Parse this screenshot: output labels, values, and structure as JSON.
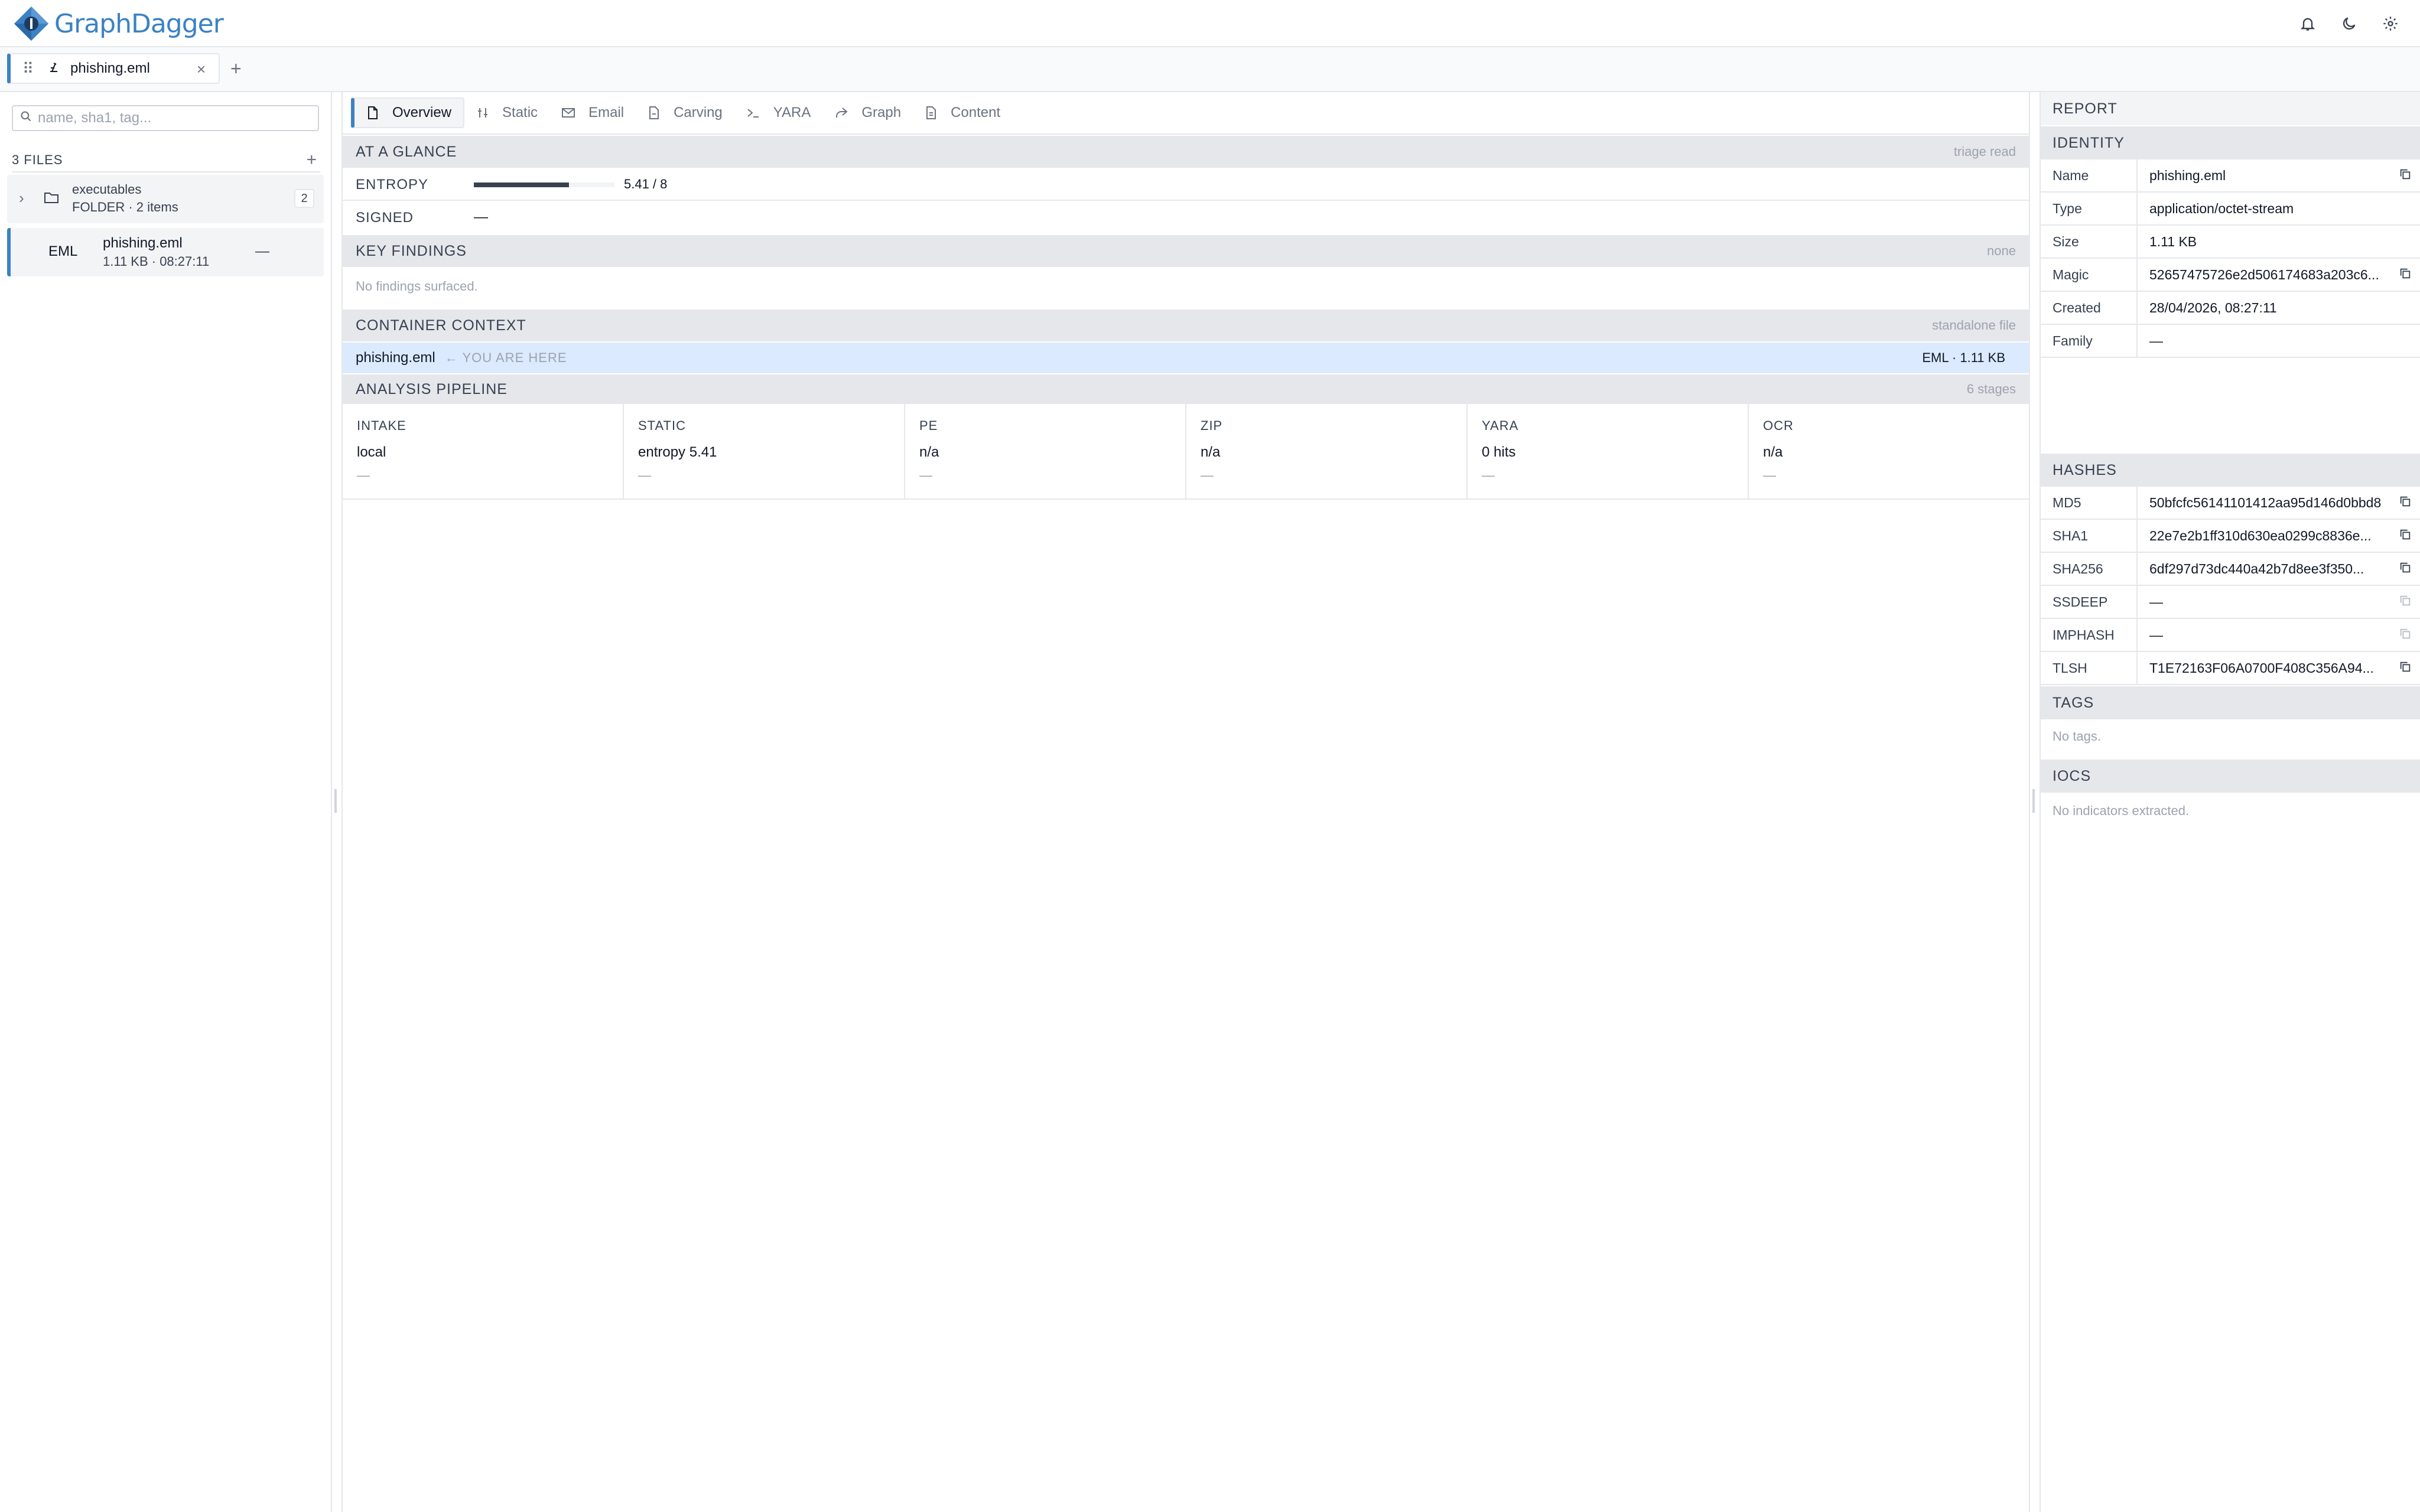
{
  "app": {
    "name": "GraphDagger"
  },
  "doc_tab": {
    "label": "phishing.eml",
    "close": "×",
    "add": "+"
  },
  "sidebar": {
    "search_placeholder": "name, sha1, tag...",
    "files_label": "3 FILES",
    "add": "+",
    "folder": {
      "name": "executables",
      "meta": "FOLDER · 2 items",
      "count": "2"
    },
    "file": {
      "ext": "EML",
      "name": "phishing.eml",
      "meta": "1.11 KB · 08:27:11",
      "status": "—"
    }
  },
  "tabs": [
    {
      "label": "Overview",
      "icon": "file-icon"
    },
    {
      "label": "Static",
      "icon": "sliders-icon"
    },
    {
      "label": "Email",
      "icon": "mail-icon"
    },
    {
      "label": "Carving",
      "icon": "file-cut-icon"
    },
    {
      "label": "YARA",
      "icon": "terminal-icon"
    },
    {
      "label": "Graph",
      "icon": "share-icon"
    },
    {
      "label": "Content",
      "icon": "file-text-icon"
    }
  ],
  "glance": {
    "title": "AT A GLANCE",
    "meta": "triage read",
    "entropy_label": "ENTROPY",
    "entropy_value": 5.41,
    "entropy_max": 8,
    "entropy_text": "5.41 / 8",
    "signed_label": "SIGNED",
    "signed_value": "—"
  },
  "findings": {
    "title": "KEY FINDINGS",
    "meta": "none",
    "empty": "No findings surfaced."
  },
  "context": {
    "title": "CONTAINER CONTEXT",
    "meta": "standalone file",
    "file": "phishing.eml",
    "here": "← YOU ARE HERE",
    "right": "EML · 1.11 KB"
  },
  "pipeline": {
    "title": "ANALYSIS PIPELINE",
    "meta": "6 stages",
    "stages": [
      {
        "name": "INTAKE",
        "value": "local",
        "detail": "—"
      },
      {
        "name": "STATIC",
        "value": "entropy 5.41",
        "detail": "—"
      },
      {
        "name": "PE",
        "value": "n/a",
        "detail": "—"
      },
      {
        "name": "ZIP",
        "value": "n/a",
        "detail": "—"
      },
      {
        "name": "YARA",
        "value": "0 hits",
        "detail": "—"
      },
      {
        "name": "OCR",
        "value": "n/a",
        "detail": "—"
      }
    ]
  },
  "report": {
    "title": "REPORT",
    "identity_title": "IDENTITY",
    "identity": [
      {
        "key": "Name",
        "value": "phishing.eml",
        "copy": true
      },
      {
        "key": "Type",
        "value": "application/octet-stream",
        "copy": false
      },
      {
        "key": "Size",
        "value": "1.11 KB",
        "copy": false
      },
      {
        "key": "Magic",
        "value": "52657475726e2d506174683a203c6...",
        "copy": true
      },
      {
        "key": "Created",
        "value": "28/04/2026, 08:27:11",
        "copy": false
      },
      {
        "key": "Family",
        "value": "—",
        "copy": false
      }
    ],
    "hashes_title": "HASHES",
    "hashes": [
      {
        "key": "MD5",
        "value": "50bfcfc56141101412aa95d146d0bbd8",
        "copy": true,
        "enabled": true
      },
      {
        "key": "SHA1",
        "value": "22e7e2b1ff310d630ea0299c8836e...",
        "copy": true,
        "enabled": true
      },
      {
        "key": "SHA256",
        "value": "6df297d73dc440a42b7d8ee3f350...",
        "copy": true,
        "enabled": true
      },
      {
        "key": "SSDEEP",
        "value": "—",
        "copy": true,
        "enabled": false
      },
      {
        "key": "IMPHASH",
        "value": "—",
        "copy": true,
        "enabled": false
      },
      {
        "key": "TLSH",
        "value": "T1E72163F06A0700F408C356A94...",
        "copy": true,
        "enabled": true
      }
    ],
    "tags_title": "TAGS",
    "tags_empty": "No tags.",
    "iocs_title": "IOCS",
    "iocs_empty": "No indicators extracted."
  },
  "colors": {
    "accent": "#3b82c4",
    "section_bg": "#e5e7eb",
    "context_highlight": "#dbeafe"
  }
}
